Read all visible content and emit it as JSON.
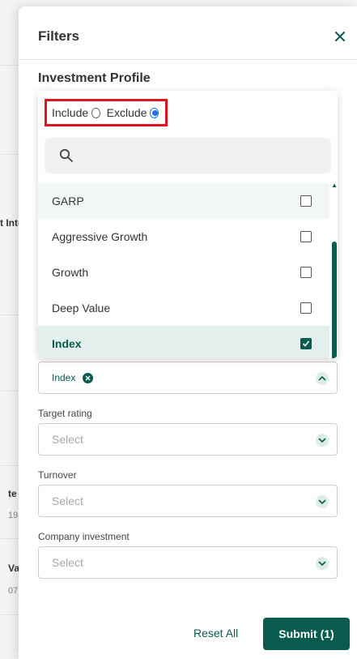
{
  "background": {
    "column_header_fragment": "t Inte",
    "row_1_title": "te",
    "row_1_sub": "19",
    "row_2_title": "Va",
    "row_2_sub": "07"
  },
  "panel": {
    "title": "Filters",
    "close_icon": "close-icon",
    "section_title": "Investment Profile"
  },
  "dropdown": {
    "include_label": "Include",
    "exclude_label": "Exclude",
    "mode_selected": "Exclude",
    "search_placeholder": "",
    "options": [
      {
        "label": "GARP",
        "checked": false
      },
      {
        "label": "Aggressive Growth",
        "checked": false
      },
      {
        "label": "Growth",
        "checked": false
      },
      {
        "label": "Deep Value",
        "checked": false
      },
      {
        "label": "Index",
        "checked": true
      }
    ]
  },
  "fields": {
    "investment_profile_chip": "Index",
    "target_rating": {
      "label": "Target rating",
      "placeholder": "Select"
    },
    "turnover": {
      "label": "Turnover",
      "placeholder": "Select"
    },
    "company_investment": {
      "label": "Company investment",
      "placeholder": "Select"
    }
  },
  "footer": {
    "reset_label": "Reset All",
    "submit_label": "Submit (1)"
  },
  "colors": {
    "accent": "#0a5b4f",
    "highlight_border": "#e0131e",
    "radio_selected": "#1a73e8"
  }
}
